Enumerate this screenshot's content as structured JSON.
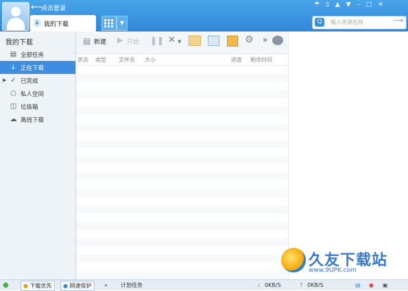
{
  "header": {
    "login_label": "点击登录",
    "tab_label": "我的下载",
    "search_placeholder": "输入资源名称"
  },
  "sidebar": {
    "title": "我的下载",
    "items": [
      {
        "label": "全部任务",
        "icon": "document-icon"
      },
      {
        "label": "正在下载",
        "icon": "download-arrow-icon",
        "active": true
      },
      {
        "label": "已完成",
        "icon": "checkmark-icon"
      },
      {
        "label": "私人空间",
        "icon": "lock-icon"
      },
      {
        "label": "垃圾箱",
        "icon": "trash-icon"
      },
      {
        "label": "离线下载",
        "icon": "cloud-download-icon"
      }
    ]
  },
  "toolbar": {
    "new_label": "新建",
    "start_label": "开始"
  },
  "table": {
    "columns": [
      "状态",
      "类型",
      "文件名",
      "大小",
      "进度",
      "剩余时间"
    ]
  },
  "statusbar": {
    "priority_label": "下载优先",
    "protect_label": "网速保护",
    "schedule_label": "计划任务",
    "download_speed": "0KB/S",
    "upload_speed": "0KB/S"
  },
  "watermark": {
    "brand": "久友下载站",
    "url": "www.9UPK.com"
  }
}
